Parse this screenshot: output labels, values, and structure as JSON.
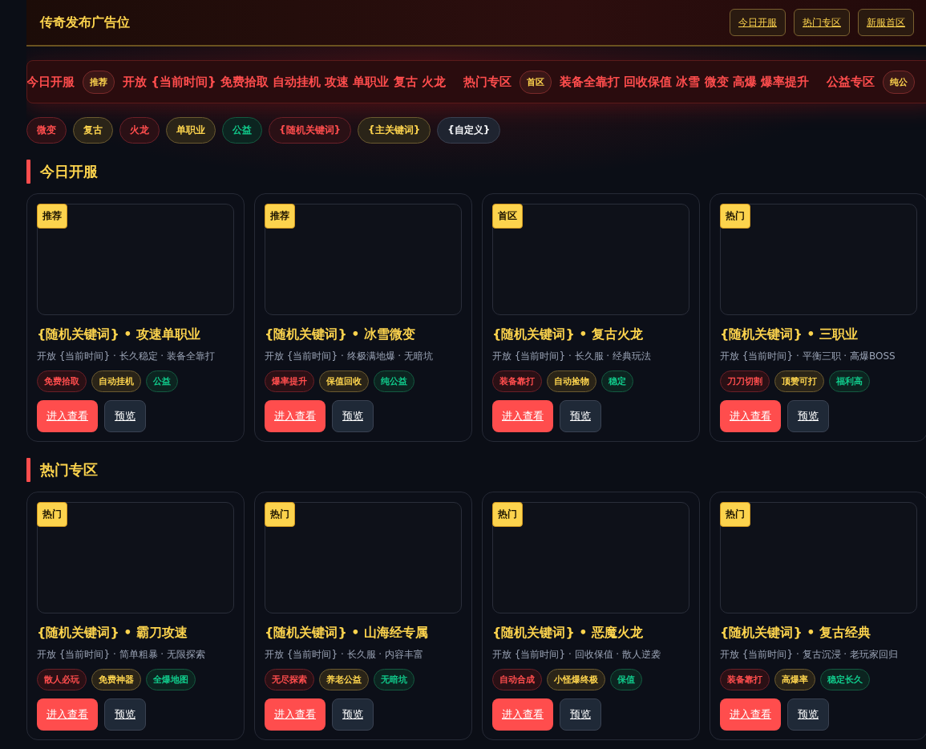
{
  "header": {
    "title": "传奇发布广告位",
    "nav": [
      "今日开服",
      "热门专区",
      "新服首区"
    ]
  },
  "ticker": [
    {
      "kind": "text",
      "text": "今日开服"
    },
    {
      "kind": "badge",
      "text": "推荐"
    },
    {
      "kind": "text",
      "text": "开放 {当前时间} 免费拾取 自动挂机 攻速 单职业 复古 火龙"
    },
    {
      "kind": "text",
      "text": "热门专区"
    },
    {
      "kind": "badge",
      "text": "首区"
    },
    {
      "kind": "text",
      "text": "装备全靠打 回收保值 冰雪 微变 高爆 爆率提升"
    },
    {
      "kind": "text",
      "text": "公益专区"
    },
    {
      "kind": "badge",
      "text": "纯公"
    }
  ],
  "filters": [
    {
      "label": "微变",
      "kind": "red"
    },
    {
      "label": "复古",
      "kind": "gold"
    },
    {
      "label": "火龙",
      "kind": "red"
    },
    {
      "label": "单职业",
      "kind": "gold"
    },
    {
      "label": "公益",
      "kind": "green"
    },
    {
      "label": "{随机关键词}",
      "kind": "red"
    },
    {
      "label": "{主关键词}",
      "kind": "gold"
    },
    {
      "label": "{自定义}",
      "kind": "plain"
    }
  ],
  "sections": [
    {
      "title": "今日开服",
      "cards": [
        {
          "badge": "推荐",
          "title": "{随机关键词} • 攻速单职业",
          "subtitle": "开放 {当前时间} · 长久稳定 · 装备全靠打",
          "tags": [
            {
              "label": "免费拾取",
              "kind": "red"
            },
            {
              "label": "自动挂机",
              "kind": "gold"
            },
            {
              "label": "公益",
              "kind": "green"
            }
          ],
          "primary": "进入查看",
          "secondary": "预览"
        },
        {
          "badge": "推荐",
          "title": "{随机关键词} • 冰雪微变",
          "subtitle": "开放 {当前时间} · 终极满地爆 · 无暗坑",
          "tags": [
            {
              "label": "爆率提升",
              "kind": "red"
            },
            {
              "label": "保值回收",
              "kind": "gold"
            },
            {
              "label": "纯公益",
              "kind": "green"
            }
          ],
          "primary": "进入查看",
          "secondary": "预览"
        },
        {
          "badge": "首区",
          "title": "{随机关键词} • 复古火龙",
          "subtitle": "开放 {当前时间} · 长久服 · 经典玩法",
          "tags": [
            {
              "label": "装备靠打",
              "kind": "red"
            },
            {
              "label": "自动捡物",
              "kind": "gold"
            },
            {
              "label": "稳定",
              "kind": "green"
            }
          ],
          "primary": "进入查看",
          "secondary": "预览"
        },
        {
          "badge": "热门",
          "title": "{随机关键词} • 三职业",
          "subtitle": "开放 {当前时间} · 平衡三职 · 高爆BOSS",
          "tags": [
            {
              "label": "刀刀切割",
              "kind": "red"
            },
            {
              "label": "顶赞可打",
              "kind": "gold"
            },
            {
              "label": "福利高",
              "kind": "green"
            }
          ],
          "primary": "进入查看",
          "secondary": "预览"
        }
      ]
    },
    {
      "title": "热门专区",
      "cards": [
        {
          "badge": "热门",
          "title": "{随机关键词} • 霸刀攻速",
          "subtitle": "开放 {当前时间} · 简单粗暴 · 无限探索",
          "tags": [
            {
              "label": "散人必玩",
              "kind": "red"
            },
            {
              "label": "免费神器",
              "kind": "gold"
            },
            {
              "label": "全爆地图",
              "kind": "green"
            }
          ],
          "primary": "进入查看",
          "secondary": "预览"
        },
        {
          "badge": "热门",
          "title": "{随机关键词} • 山海经专属",
          "subtitle": "开放 {当前时间} · 长久服 · 内容丰富",
          "tags": [
            {
              "label": "无尽探索",
              "kind": "red"
            },
            {
              "label": "养老公益",
              "kind": "gold"
            },
            {
              "label": "无暗坑",
              "kind": "green"
            }
          ],
          "primary": "进入查看",
          "secondary": "预览"
        },
        {
          "badge": "热门",
          "title": "{随机关键词} • 恶魔火龙",
          "subtitle": "开放 {当前时间} · 回收保值 · 散人逆袭",
          "tags": [
            {
              "label": "自动合成",
              "kind": "red"
            },
            {
              "label": "小怪爆终极",
              "kind": "gold"
            },
            {
              "label": "保值",
              "kind": "green"
            }
          ],
          "primary": "进入查看",
          "secondary": "预览"
        },
        {
          "badge": "热门",
          "title": "{随机关键词} • 复古经典",
          "subtitle": "开放 {当前时间} · 复古沉浸 · 老玩家回归",
          "tags": [
            {
              "label": "装备靠打",
              "kind": "red"
            },
            {
              "label": "高爆率",
              "kind": "gold"
            },
            {
              "label": "稳定长久",
              "kind": "green"
            }
          ],
          "primary": "进入查看",
          "secondary": "预览"
        }
      ]
    }
  ]
}
